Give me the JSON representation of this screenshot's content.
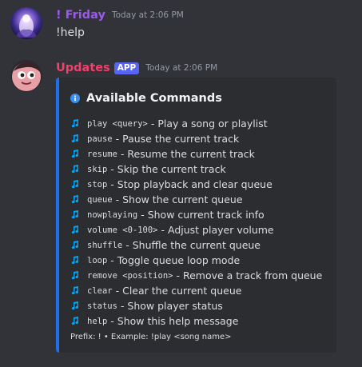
{
  "message1": {
    "username": "! Friday",
    "timestamp": "Today at 2:06 PM",
    "text": "!help"
  },
  "message2": {
    "username": "Updates",
    "badge": "APP",
    "timestamp": "Today at 2:06 PM",
    "embed": {
      "title": "Available Commands",
      "commands": [
        {
          "code": "play <query>",
          "desc": "- Play a song or playlist"
        },
        {
          "code": "pause",
          "desc": "- Pause the current track"
        },
        {
          "code": "resume",
          "desc": "- Resume the current track"
        },
        {
          "code": "skip",
          "desc": "- Skip the current track"
        },
        {
          "code": "stop",
          "desc": "- Stop playback and clear queue"
        },
        {
          "code": "queue",
          "desc": "- Show the current queue"
        },
        {
          "code": "nowplaying",
          "desc": "- Show current track info"
        },
        {
          "code": "volume <0-100>",
          "desc": "- Adjust player volume"
        },
        {
          "code": "shuffle",
          "desc": "- Shuffle the current queue"
        },
        {
          "code": "loop",
          "desc": "- Toggle queue loop mode"
        },
        {
          "code": "remove <position>",
          "desc": "- Remove a track from queue"
        },
        {
          "code": "clear",
          "desc": "- Clear the current queue"
        },
        {
          "code": "status",
          "desc": "- Show player status"
        },
        {
          "code": "help",
          "desc": "- Show this help message"
        }
      ],
      "footer": "Prefix: ! • Example: !play <song name>"
    }
  },
  "colors": {
    "background": "#323339",
    "embed_background": "#2b2d31",
    "embed_accent": "#1f6feb",
    "friday_name": "#9b59f0",
    "updates_name": "#f23f6b",
    "app_badge": "#5865f2",
    "note_icon": "#00a8fc"
  },
  "icons": {
    "title_icon": "info-icon",
    "command_icon": "music-note-icon"
  }
}
